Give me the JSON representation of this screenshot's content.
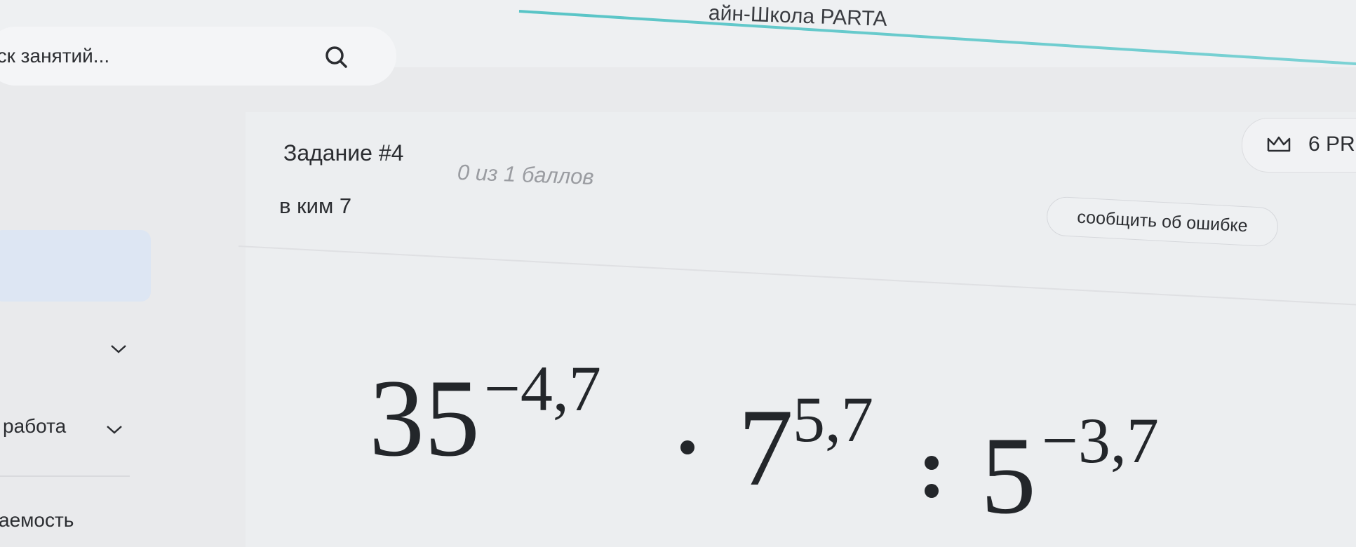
{
  "header": {
    "app_title": "айн-Школа PARTA"
  },
  "search": {
    "placeholder": "иск занятий..."
  },
  "sidebar": {
    "items": [
      {
        "label": "работа"
      },
      {
        "label": "аемость"
      }
    ]
  },
  "task": {
    "title": "Задание #4",
    "score": "0 из 1 баллов",
    "subtitle": "в ким 7",
    "report_label": "сообщить об ошибке"
  },
  "badge": {
    "points_label": "6 PR"
  },
  "formula": {
    "term1_base": "35",
    "term1_exp": "−4,7",
    "op1": "·",
    "term2_base": "7",
    "term2_exp": "5,7",
    "op2": ":",
    "term3_base": "5",
    "term3_exp": "−3,7"
  },
  "colors": {
    "accent_line": "#58c4c6",
    "sidebar_active": "#dde6f3",
    "muted_text": "#9a9ca1"
  }
}
